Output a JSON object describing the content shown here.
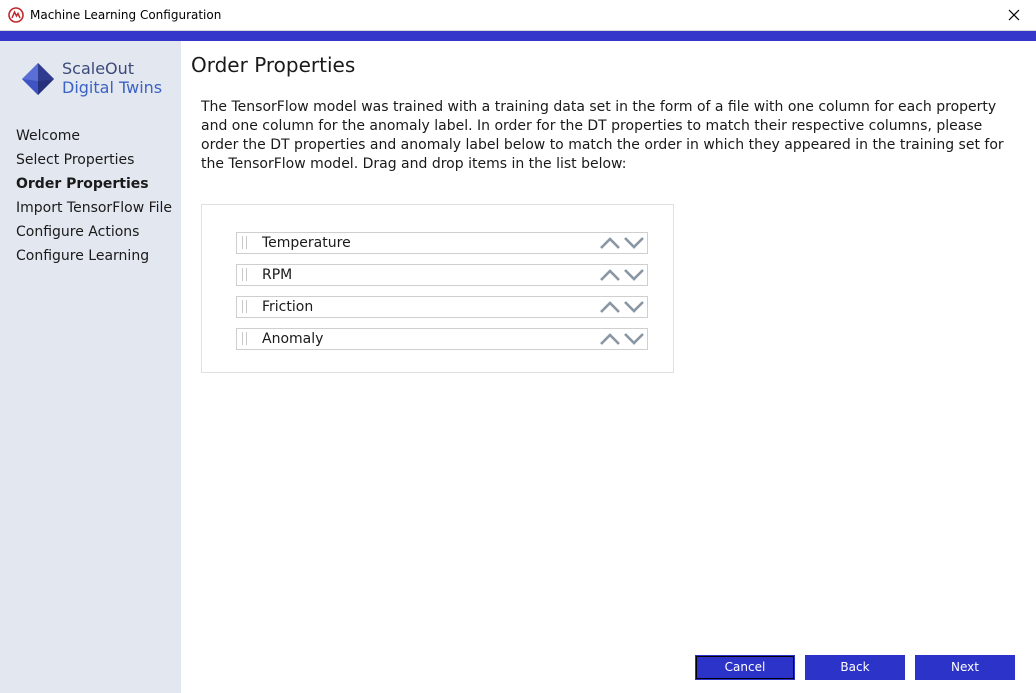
{
  "window": {
    "title": "Machine Learning Configuration",
    "app_icon": "app-logo-icon",
    "close_icon": "close-icon",
    "accent_color": "#3437c9"
  },
  "sidebar": {
    "logo": {
      "line1": "ScaleOut",
      "line2": "Digital Twins"
    },
    "items": [
      {
        "label": "Welcome",
        "active": false
      },
      {
        "label": "Select Properties",
        "active": false
      },
      {
        "label": "Order Properties",
        "active": true
      },
      {
        "label": "Import TensorFlow File",
        "active": false
      },
      {
        "label": "Configure Actions",
        "active": false
      },
      {
        "label": "Configure Learning",
        "active": false
      }
    ]
  },
  "main": {
    "title": "Order Properties",
    "description": "The TensorFlow model was trained with a training data set in the form of a file with one column for each property and one column for the anomaly label. In order for the DT properties to match their respective columns, please order the DT properties and anomaly label below to match the order in which they appeared in the training set for the TensorFlow model. Drag and drop items in the list below:",
    "list": [
      {
        "label": "Temperature"
      },
      {
        "label": "RPM"
      },
      {
        "label": "Friction"
      },
      {
        "label": "Anomaly"
      }
    ]
  },
  "footer": {
    "cancel_label": "Cancel",
    "back_label": "Back",
    "next_label": "Next",
    "button_color": "#2c33c9"
  }
}
